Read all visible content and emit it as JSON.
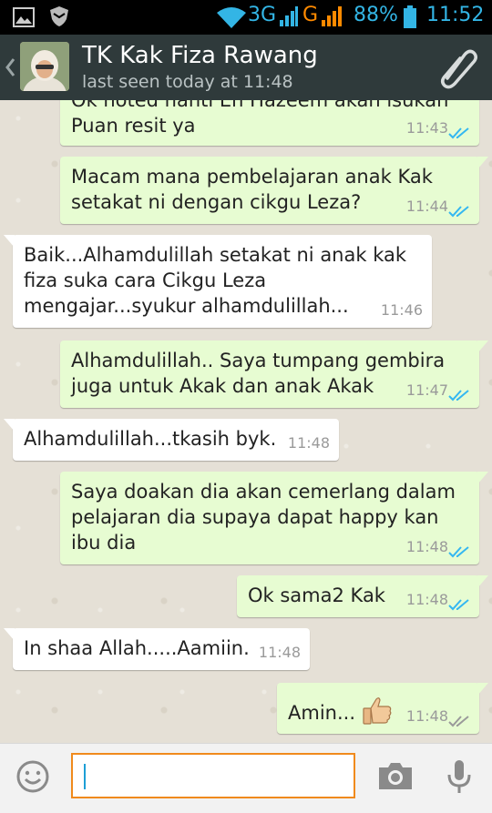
{
  "status_bar": {
    "network_3g": "3G",
    "network_g": "G",
    "battery": "88%",
    "time": "11:52"
  },
  "header": {
    "contact_name": "TK Kak Fiza Rawang",
    "last_seen": "last seen today at 11:48",
    "back_icon": "chevron-left-icon",
    "attach_icon": "paperclip-icon"
  },
  "messages": [
    {
      "direction": "out",
      "text": "Ok noted nanti En Hazeem akan isukan Puan resit ya",
      "time": "11:43",
      "status": "read"
    },
    {
      "direction": "out",
      "text": "Macam mana pembelajaran anak Kak setakat ni dengan cikgu Leza?",
      "time": "11:44",
      "status": "read"
    },
    {
      "direction": "in",
      "text": "Baik...Alhamdulillah setakat ni anak kak fiza suka cara Cikgu Leza mengajar...syukur alhamdulillah...",
      "time": "11:46"
    },
    {
      "direction": "out",
      "text": "Alhamdulillah.. Saya tumpang gembira juga untuk Akak dan anak Akak",
      "time": "11:47",
      "status": "read"
    },
    {
      "direction": "in",
      "text": "Alhamdulillah...tkasih byk.",
      "time": "11:48"
    },
    {
      "direction": "out",
      "text": "Saya doakan dia akan cemerlang dalam pelajaran dia supaya dapat happy kan ibu dia",
      "time": "11:48",
      "status": "read"
    },
    {
      "direction": "out",
      "text": "Ok sama2 Kak",
      "time": "11:48",
      "status": "read"
    },
    {
      "direction": "in",
      "text": "In shaa Allah.....Aamiin.",
      "time": "11:48"
    },
    {
      "direction": "out",
      "text": "Amin...",
      "time": "11:48",
      "status": "delivered",
      "emoji": "thumbs-up-icon"
    }
  ],
  "input_bar": {
    "emoji_icon": "smiley-icon",
    "camera_icon": "camera-icon",
    "mic_icon": "microphone-icon",
    "value": "",
    "placeholder": ""
  },
  "colors": {
    "header_bg": "#2f3a3b",
    "outgoing_bubble": "#e7fcd2",
    "incoming_bubble": "#ffffff",
    "read_tick": "#34b7f1",
    "status_accent": "#33b5e5",
    "input_focus": "#f08a1c"
  }
}
